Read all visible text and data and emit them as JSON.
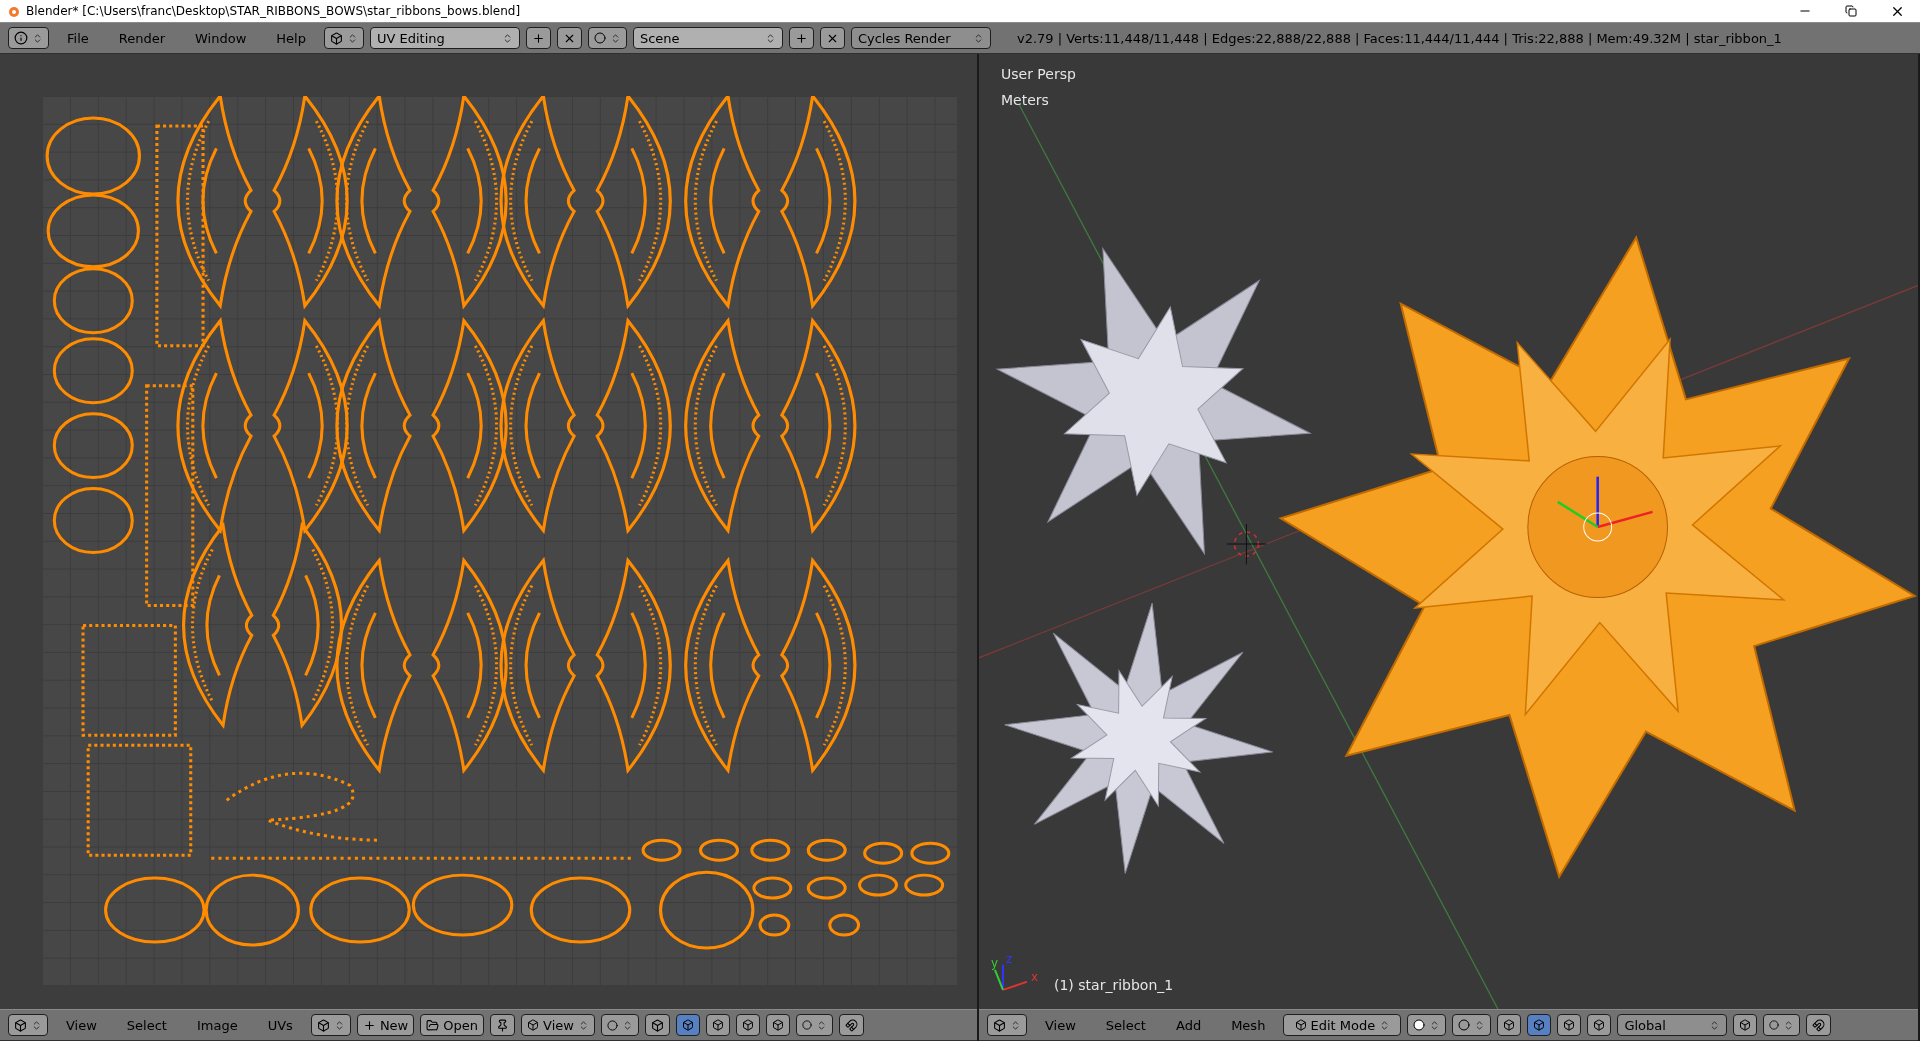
{
  "title_bar": {
    "title": "Blender* [C:\\Users\\franc\\Desktop\\STAR_RIBBONS_BOWS\\star_ribbons_bows.blend]"
  },
  "top_header": {
    "menus": [
      "File",
      "Render",
      "Window",
      "Help"
    ],
    "screen_layout": "UV Editing",
    "scene": "Scene",
    "render_engine": "Cycles Render",
    "stats": "v2.79 | Verts:11,448/11,448 | Edges:22,888/22,888 | Faces:11,444/11,444 | Tris:22,888 | Mem:49.32M | star_ribbon_1"
  },
  "uv_editor": {
    "menus": [
      "View",
      "Select",
      "Image",
      "UVs"
    ],
    "new_button": "New",
    "open_button": "Open",
    "view_mode": "View",
    "select_modes": [
      {
        "selected": true
      },
      {
        "selected": false
      },
      {
        "selected": false
      },
      {
        "selected": false
      }
    ]
  },
  "viewport_3d": {
    "view_name": "User Persp",
    "units": "Meters",
    "axis_labels": [
      "x",
      "y",
      "z"
    ],
    "active_object": "(1) star_ribbon_1",
    "menus": [
      "View",
      "Select",
      "Add",
      "Mesh"
    ],
    "mode": "Edit Mode",
    "manipulators": [
      {
        "selected": false
      },
      {
        "selected": true
      },
      {
        "selected": false
      },
      {
        "selected": false
      }
    ],
    "orientation": "Global"
  }
}
